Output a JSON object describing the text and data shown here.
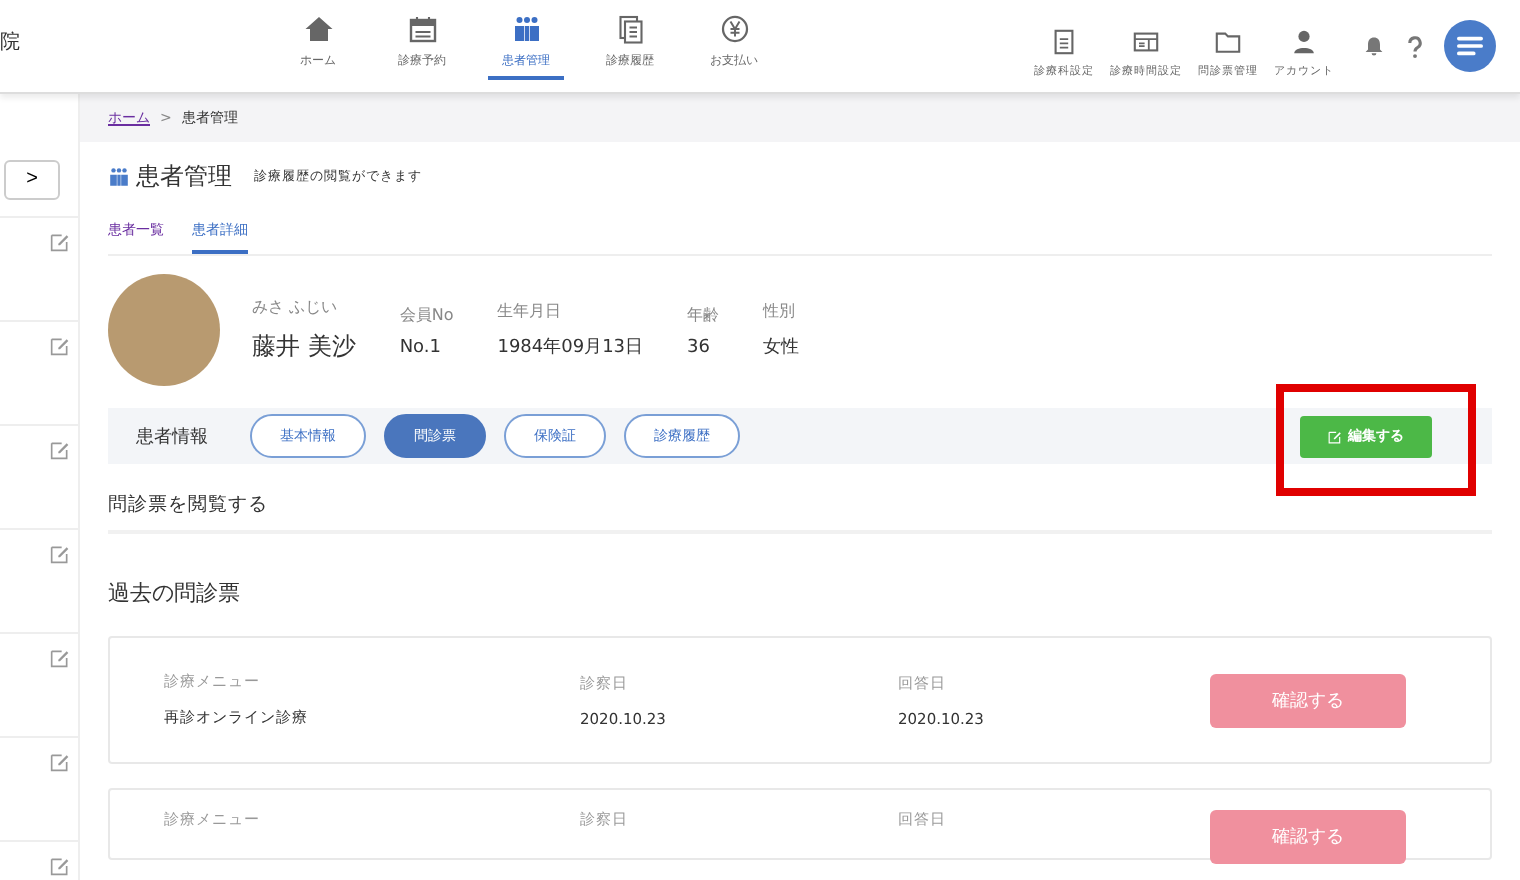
{
  "header": {
    "clinic_name": "院",
    "nav": [
      {
        "kind": "home",
        "label": "ホーム",
        "selected": false
      },
      {
        "kind": "calendar",
        "label": "診療予約",
        "selected": false
      },
      {
        "kind": "people",
        "label": "患者管理",
        "selected": true
      },
      {
        "kind": "docs",
        "label": "診療履歴",
        "selected": false
      },
      {
        "kind": "yen",
        "label": "お支払い",
        "selected": false
      }
    ],
    "tools": [
      {
        "kind": "doc",
        "label": "診療科設定"
      },
      {
        "kind": "layout",
        "label": "診療時間設定"
      },
      {
        "kind": "folder",
        "label": "問診票管理"
      },
      {
        "kind": "person",
        "label": "アカウント"
      }
    ]
  },
  "sidebar": {
    "pager_next": ">",
    "rows": [
      {
        "edit_icon": true
      },
      {
        "edit_icon": true
      },
      {
        "edit_icon": true
      },
      {
        "edit_icon": true
      },
      {
        "edit_icon": true
      },
      {
        "edit_icon": true
      },
      {
        "edit_icon": true
      }
    ]
  },
  "breadcrumb_separator": ">",
  "breadcrumb": [
    {
      "label": "ホーム",
      "link": true
    },
    {
      "label": "患者管理",
      "link": false
    }
  ],
  "page": {
    "title": "患者管理",
    "subtitle": "診療履歴の閲覧ができます"
  },
  "tabs": [
    {
      "label": "患者一覧",
      "selected": false
    },
    {
      "label": "患者詳細",
      "selected": true
    }
  ],
  "patient": {
    "kana": "みさ ふじい",
    "name": "藤井 美沙",
    "fields": [
      {
        "label": "会員No",
        "value": "No.1"
      },
      {
        "label": "生年月日",
        "value": "1984年09月13日"
      },
      {
        "label": "年齢",
        "value": "36"
      },
      {
        "label": "性別",
        "value": "女性"
      }
    ]
  },
  "info_bar": {
    "label": "患者情報",
    "pills": [
      {
        "label": "基本情報",
        "selected": false
      },
      {
        "label": "問診票",
        "selected": true
      },
      {
        "label": "保険証",
        "selected": false
      },
      {
        "label": "診療履歴",
        "selected": false
      }
    ],
    "edit_button": "編集する"
  },
  "section_title": "問診票を閲覧する",
  "past_title": "過去の問診票",
  "cards": [
    {
      "fields": [
        {
          "label": "診療メニュー",
          "value": "再診オンライン診療"
        },
        {
          "label": "診察日",
          "value": "2020.10.23"
        },
        {
          "label": "回答日",
          "value": "2020.10.23"
        }
      ],
      "button": "確認する"
    },
    {
      "fields": [
        {
          "label": "診療メニュー"
        },
        {
          "label": "診察日"
        },
        {
          "label": "回答日"
        }
      ],
      "button": "確認する"
    }
  ]
}
